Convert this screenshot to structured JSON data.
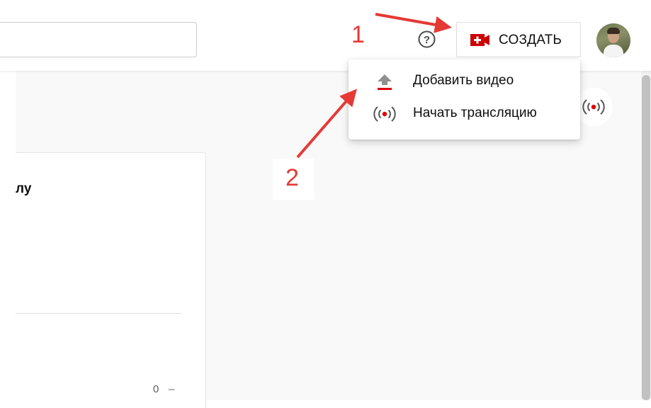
{
  "header": {
    "search_placeholder": "",
    "help_icon": "help-circle-icon",
    "create_button_label": "СОЗДАТЬ",
    "create_icon": "video-camera-plus-icon",
    "avatar_icon": "user-avatar"
  },
  "create_menu": {
    "items": [
      {
        "label": "Добавить видео",
        "icon": "upload-icon"
      },
      {
        "label": "Начать трансляцию",
        "icon": "live-broadcast-icon"
      }
    ]
  },
  "main": {
    "card_title_fragment": "лу",
    "card_count": "0",
    "card_dash": "–",
    "live_icon": "live-broadcast-icon"
  },
  "annotations": {
    "step1": "1",
    "step2": "2"
  },
  "colors": {
    "accent_red": "#cc0000",
    "annotation_red": "#e53935",
    "background": "#f9f9f9"
  }
}
